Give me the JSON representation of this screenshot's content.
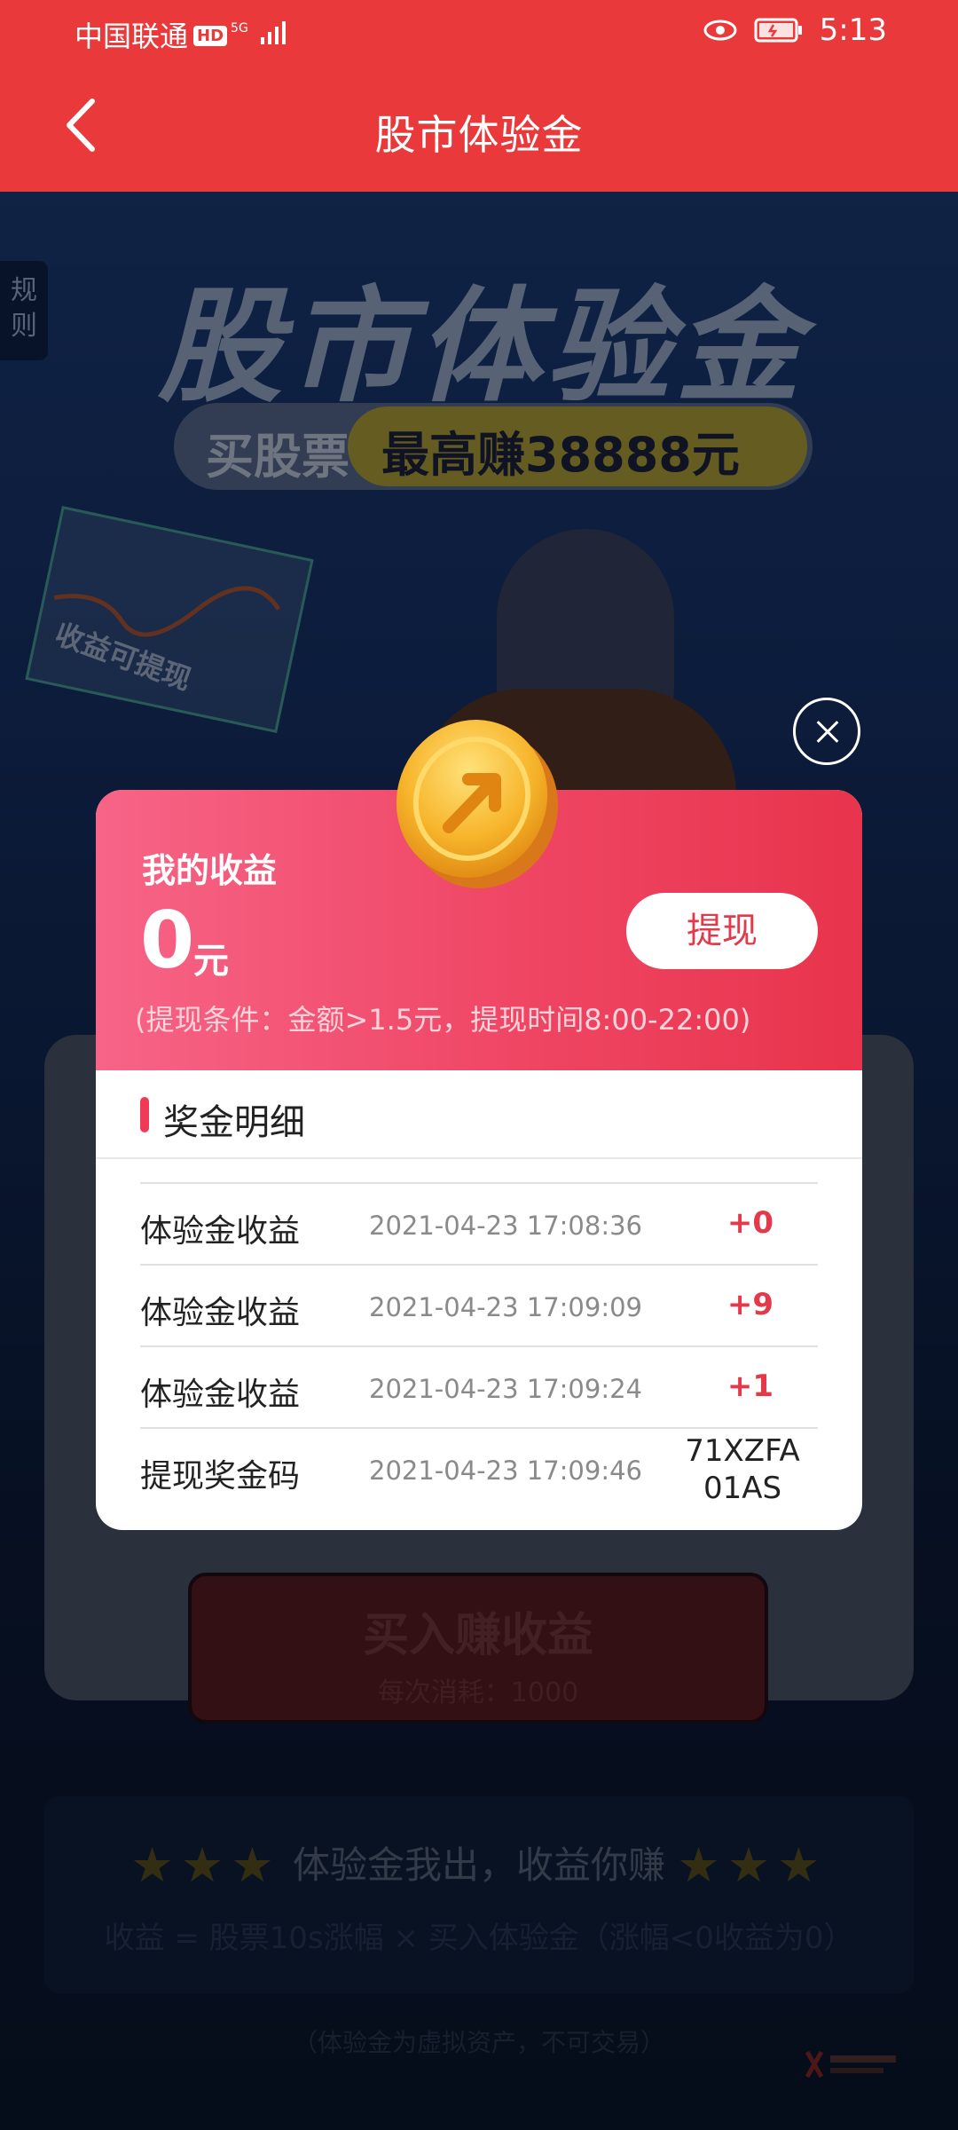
{
  "status_bar": {
    "carrier": "中国联通",
    "hd_badge": "HD",
    "network": "5G",
    "time": "5:13"
  },
  "header": {
    "title": "股市体验金"
  },
  "background": {
    "rules_tab": "规则",
    "hero_title": "股市体验金",
    "hero_badge_left": "买股票",
    "hero_badge_right": "最高赚38888元",
    "hero_card_text": "收益可提现",
    "buy_button_label": "买入赚收益",
    "buy_button_sub": "每次消耗：1000",
    "slogan": "体验金我出，收益你赚",
    "formula": "收益 = 股票10s涨幅 × 买入体验金（涨幅<0收益为0）",
    "footer_note": "（体验金为虚拟资产，不可交易）"
  },
  "modal": {
    "earnings_label": "我的收益",
    "amount": "0",
    "unit": "元",
    "withdraw_label": "提现",
    "condition": "(提现条件：金额>1.5元，提现时间8:00-22:00)",
    "section_title": "奖金明细",
    "rows": [
      {
        "name": "体验金收益",
        "time": "2021-04-23 17:08:36",
        "value": "+0"
      },
      {
        "name": "体验金收益",
        "time": "2021-04-23 17:09:09",
        "value": "+9"
      },
      {
        "name": "体验金收益",
        "time": "2021-04-23 17:09:24",
        "value": "+1"
      },
      {
        "name": "提现奖金码",
        "time": "2021-04-23 17:09:46",
        "value": "71XZFA01AS"
      }
    ]
  },
  "colors": {
    "header_red": "#e9393a",
    "modal_gradient_start": "#f76487",
    "modal_gradient_end": "#e8344c",
    "accent_red": "#e23a4b",
    "coin_gold": "#f7b52c"
  }
}
